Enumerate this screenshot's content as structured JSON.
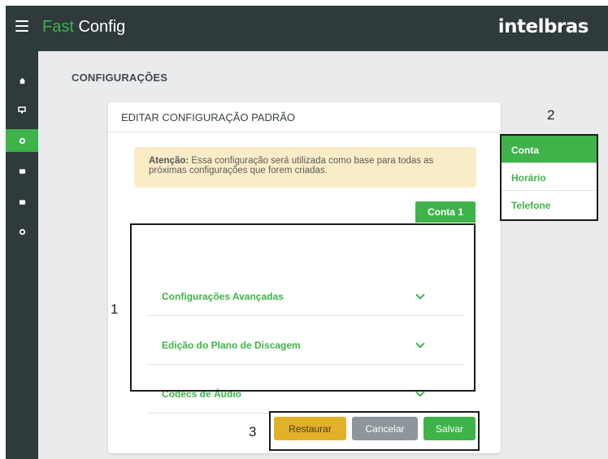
{
  "header": {
    "brand_accent": "Fast",
    "brand_rest": " Config",
    "logo": "intelbras"
  },
  "sidebar": {
    "items": [
      {
        "icon": "home-icon",
        "glyph": "⌂"
      },
      {
        "icon": "monitor-icon",
        "glyph": "▭"
      },
      {
        "icon": "settings-icon",
        "glyph": "⚙"
      },
      {
        "icon": "folder-icon",
        "glyph": "▬"
      },
      {
        "icon": "folder-icon",
        "glyph": "▬"
      },
      {
        "icon": "settings-icon",
        "glyph": "⚙"
      }
    ],
    "active_index": 2
  },
  "page": {
    "title": "CONFIGURAÇÕES"
  },
  "card": {
    "title": "EDITAR CONFIGURAÇÃO PADRÃO",
    "alert_strong": "Atenção:",
    "alert_text": " Essa configuração será utilizada como base para todas as próximas configurações que forem criadas.",
    "account_tab": "Conta 1",
    "accordions": [
      {
        "label": "Configurações Avançadas"
      },
      {
        "label": "Edição do Plano de Discagem"
      },
      {
        "label": "Codecs de Áudio"
      }
    ],
    "buttons": {
      "restore": "Restaurar",
      "cancel": "Cancelar",
      "save": "Salvar"
    }
  },
  "right_menu": {
    "items": [
      {
        "label": "Conta"
      },
      {
        "label": "Horário"
      },
      {
        "label": "Telefone"
      }
    ],
    "active_index": 0
  },
  "annotations": {
    "n1": "1",
    "n2": "2",
    "n3": "3"
  },
  "colors": {
    "accent": "#3db34a",
    "topbar": "#2f3a3b",
    "background": "#e9ebed",
    "alert": "#fbecc8",
    "restore": "#e2b12a",
    "cancel": "#8d969b"
  }
}
